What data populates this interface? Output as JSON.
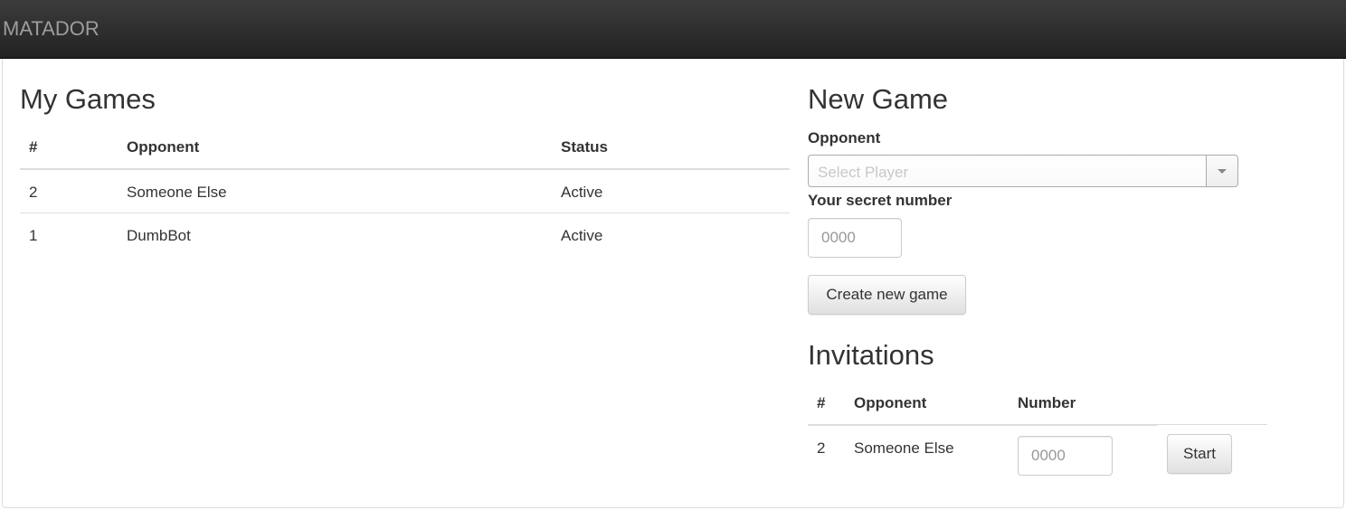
{
  "navbar": {
    "brand": "MATADOR"
  },
  "my_games": {
    "title": "My Games",
    "columns": [
      "#",
      "Opponent",
      "Status"
    ],
    "rows": [
      {
        "id": "2",
        "opponent": "Someone Else",
        "status": "Active"
      },
      {
        "id": "1",
        "opponent": "DumbBot",
        "status": "Active"
      }
    ]
  },
  "new_game": {
    "title": "New Game",
    "opponent_label": "Opponent",
    "opponent_placeholder": "Select Player",
    "secret_label": "Your secret number",
    "secret_placeholder": "0000",
    "create_button": "Create new game"
  },
  "invitations": {
    "title": "Invitations",
    "columns": [
      "#",
      "Opponent",
      "Number"
    ],
    "rows": [
      {
        "id": "2",
        "opponent": "Someone Else",
        "number_placeholder": "0000",
        "start_button": "Start"
      }
    ]
  },
  "colors": {
    "navbar": "#222222",
    "brand": "#9d9d9d",
    "text": "#333333",
    "table_border": "#dddddd"
  }
}
